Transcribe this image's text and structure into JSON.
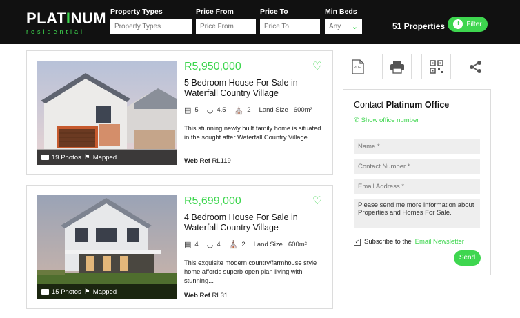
{
  "header": {
    "logo_main_1": "PLAT",
    "logo_main_mark": "I",
    "logo_main_2": "NUM",
    "logo_sub": "residential",
    "filters": [
      {
        "label": "Property Types",
        "placeholder": "Property Types"
      },
      {
        "label": "Price From",
        "placeholder": "Price From"
      },
      {
        "label": "Price To",
        "placeholder": "Price To"
      },
      {
        "label": "Min Beds",
        "value": "Any"
      }
    ],
    "property_count": "51 Properties",
    "filter_button": "Filter"
  },
  "listings": [
    {
      "price": "R5,950,000",
      "title": "5 Bedroom House For Sale in Waterfall Country Village",
      "beds": "5",
      "baths": "4.5",
      "garages": "2",
      "land_size_label": "Land Size",
      "land_size": "600m²",
      "description": "This stunning newly built family home is situated in the sought after Waterfall Country Village...",
      "web_ref_label": "Web Ref",
      "web_ref": "RL119",
      "photos": "19 Photos",
      "mapped": "Mapped"
    },
    {
      "price": "R5,699,000",
      "title": "4 Bedroom House For Sale in Waterfall Country Village",
      "beds": "4",
      "baths": "4",
      "garages": "2",
      "land_size_label": "Land Size",
      "land_size": "600m²",
      "description": "This exquisite modern country/farmhouse style home affords superb open plan living with stunning...",
      "web_ref_label": "Web Ref",
      "web_ref": "RL31",
      "photos": "15 Photos",
      "mapped": "Mapped"
    }
  ],
  "tools": [
    "pdf-icon",
    "print-icon",
    "qr-code-icon",
    "share-icon"
  ],
  "contact": {
    "title_prefix": "Contact",
    "title_name": "Platinum Office",
    "show_number": "Show office number",
    "name_placeholder": "Name *",
    "phone_placeholder": "Contact Number *",
    "email_placeholder": "Email Address *",
    "message": "Please send me more information about Properties and Homes For Sale.",
    "subscribe_prefix": "Subscribe to the",
    "subscribe_link": "Email Newsletter",
    "send_label": "Send"
  },
  "colors": {
    "accent": "#3ed64f",
    "header_bg": "#111111"
  }
}
